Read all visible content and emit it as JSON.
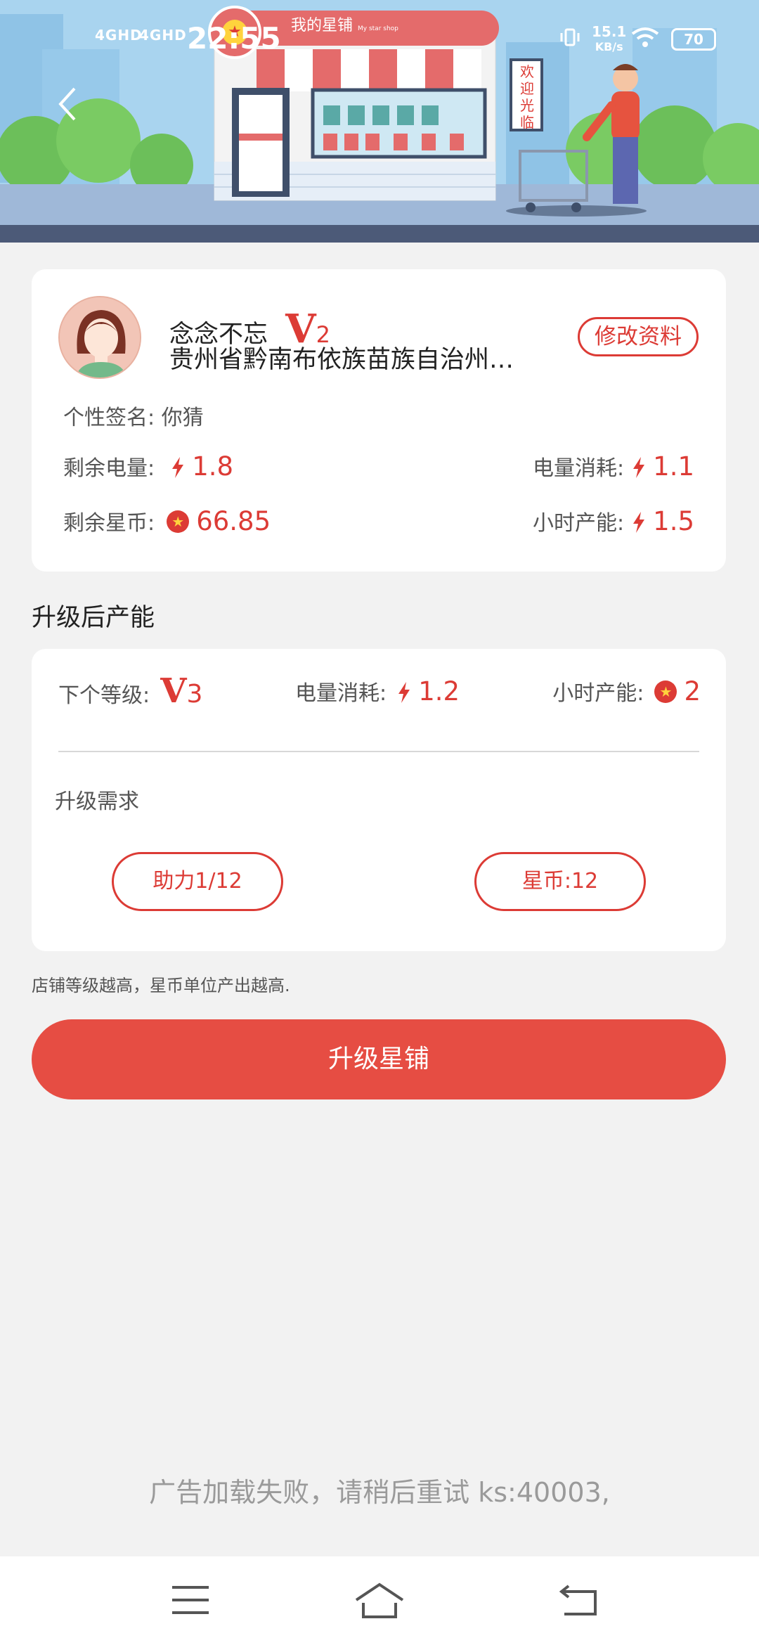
{
  "status_bar": {
    "signal1": "4GHD",
    "signal2": "4GHD",
    "time": "22:55",
    "net_speed_value": "15.1",
    "net_speed_unit": "KB/s",
    "battery": "70"
  },
  "header": {
    "store_title": "我的星铺",
    "store_subtitle": "My star shop",
    "welcome_sign": "欢迎光临"
  },
  "profile": {
    "nickname": "念念不忘",
    "level_letter": "V",
    "level_number": "2",
    "address": "贵州省黔南布依族苗族自治州…",
    "edit_button": "修改资料",
    "signature_label": "个性签名:",
    "signature_value": "你猜",
    "power_left_label": "剩余电量:",
    "power_left_value": "1.8",
    "power_cost_label": "电量消耗:",
    "power_cost_value": "1.1",
    "coins_left_label": "剩余星币:",
    "coins_left_value": "66.85",
    "hourly_output_label": "小时产能:",
    "hourly_output_value": "1.5"
  },
  "upgrade": {
    "section_title": "升级后产能",
    "next_level_label": "下个等级:",
    "next_level_letter": "V",
    "next_level_number": "3",
    "power_cost_label": "电量消耗:",
    "power_cost_value": "1.2",
    "hourly_output_label": "小时产能:",
    "hourly_output_value": "2",
    "requirements_title": "升级需求",
    "req_help": "助力1/12",
    "req_coins": "星币:12",
    "tip": "店铺等级越高，星币单位产出越高.",
    "button": "升级星铺"
  },
  "ad_message": "广告加载失败，请稍后重试 ks:40003,",
  "colors": {
    "accent": "#dc3b35",
    "button": "#e64d43",
    "background": "#f2f2f2"
  }
}
